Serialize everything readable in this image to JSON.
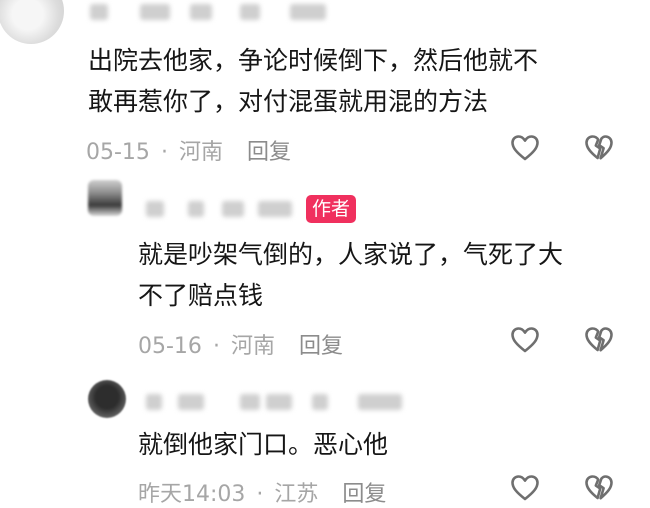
{
  "comments": [
    {
      "text": "出院去他家，争论时候倒下，然后他就不\n敢再惹你了，对付混蛋就用混的方法",
      "date": "05-15",
      "location": "河南",
      "reply_label": "回复"
    },
    {
      "author_tag": "作者",
      "text": "就是吵架气倒的，人家说了，气死了大\n不了赔点钱",
      "date": "05-16",
      "location": "河南",
      "reply_label": "回复"
    },
    {
      "text": "就倒他家门口。恶心他",
      "date": "昨天14:03",
      "location": "江苏",
      "reply_label": "回复"
    }
  ],
  "meta_separator": "·",
  "icons": {
    "like": "heart-outline-icon",
    "dislike": "broken-heart-icon"
  },
  "colors": {
    "author_tag": "#f0305e",
    "meta_text": "#a6a6a6",
    "icon_stroke": "#6f6f6f"
  }
}
